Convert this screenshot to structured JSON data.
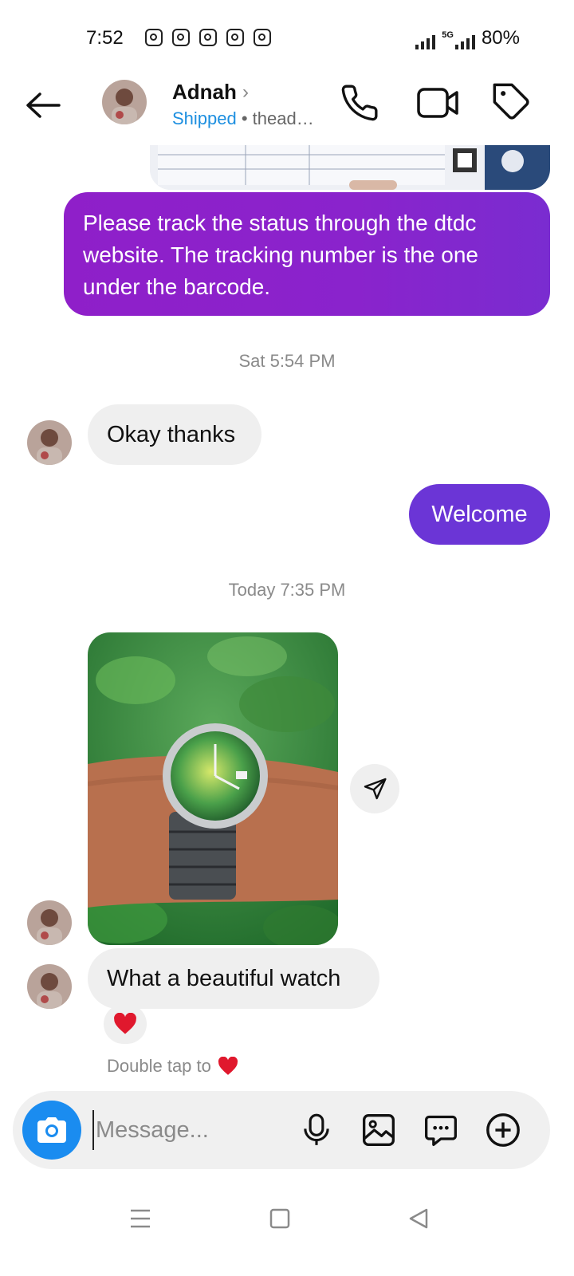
{
  "status_bar": {
    "time": "7:52",
    "notification_icons": [
      "instagram-icon",
      "instagram-icon",
      "instagram-icon",
      "instagram-icon",
      "instagram-icon"
    ],
    "network": "5G",
    "battery": "80%"
  },
  "header": {
    "name": "Adnah",
    "chevron": "›",
    "status": "Shipped",
    "subtitle": " • thead…"
  },
  "messages": {
    "outgoing_long": "Please track the status through the dtdc website. The tracking number is the one under the barcode.",
    "timestamp_1": "Sat 5:54 PM",
    "incoming_okay": "Okay thanks",
    "outgoing_welcome": "Welcome",
    "timestamp_2": "Today 7:35 PM",
    "incoming_watch": "What a beautiful watch",
    "reaction": "❤️",
    "double_tap_hint": "Double tap to"
  },
  "composer": {
    "placeholder": "Message..."
  },
  "colors": {
    "outgoing_purple": "#8a23cc",
    "outgoing_violet": "#6b35d6",
    "incoming_gray": "#efefef",
    "accent_blue": "#1a8cf0",
    "shipped_blue": "#1d8fe0",
    "heart_red": "#e0182d"
  }
}
